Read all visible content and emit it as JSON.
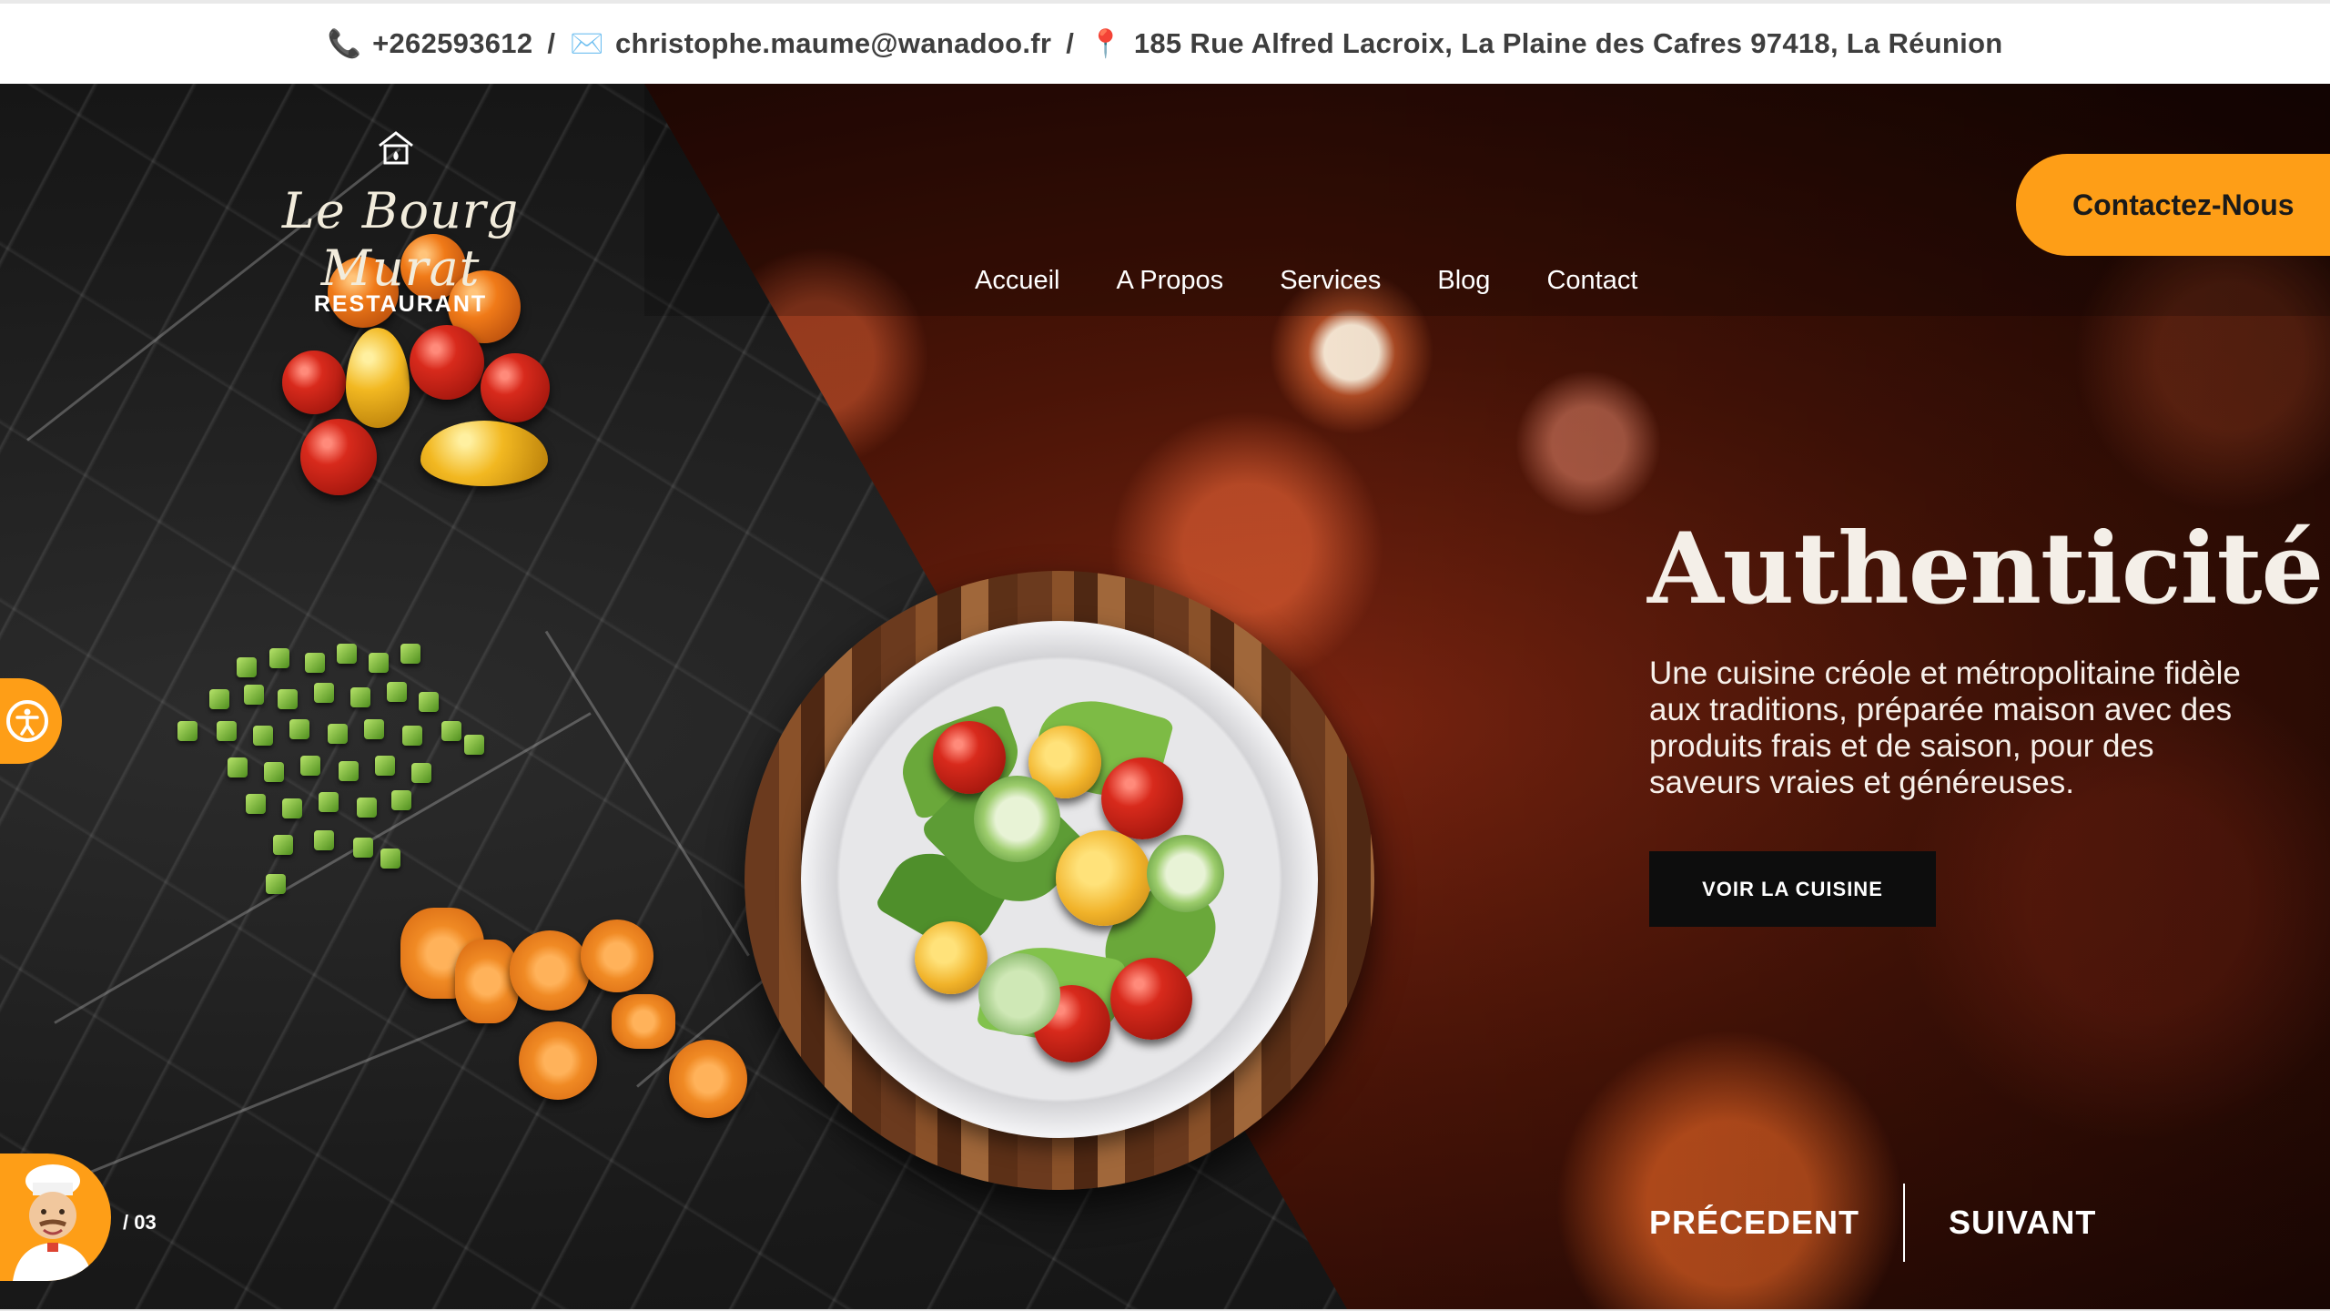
{
  "topbar": {
    "phone_icon": "phone-icon",
    "phone": "+262593612",
    "separator": "/",
    "email_icon": "envelope-icon",
    "email": "christophe.maume@wanadoo.fr",
    "address_icon": "map-pin-icon",
    "address": "185 Rue Alfred Lacroix, La Plaine des Cafres 97418, La Réunion"
  },
  "logo": {
    "name": "Le Bourg Murat",
    "subtitle": "RESTAURANT"
  },
  "nav": {
    "items": [
      "Accueil",
      "A Propos",
      "Services",
      "Blog",
      "Contact"
    ],
    "cta": "Contactez-Nous"
  },
  "hero": {
    "title": "Authenticité",
    "text": "Une cuisine créole et métropolitaine fidèle aux traditions, préparée maison avec des produits frais et de saison, pour des saveurs vraies et généreuses.",
    "button": "VOIR LA CUISINE",
    "prev": "PRÉCEDENT",
    "next": "SUIVANT",
    "counter": "/ 03"
  },
  "colors": {
    "accent": "#fe9e17",
    "dark": "#0d0d0d",
    "text_dark": "#3e3e3e"
  }
}
